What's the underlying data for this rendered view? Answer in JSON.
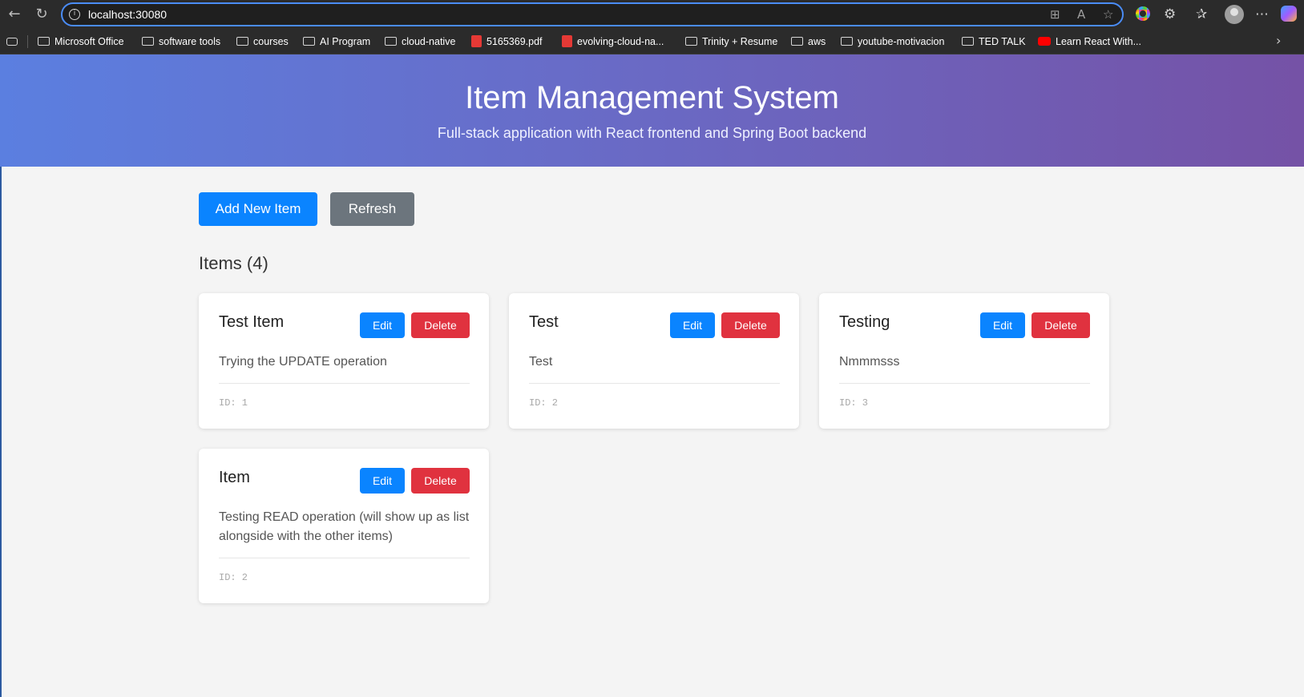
{
  "browser": {
    "url": "localhost:30080",
    "bookmarks": [
      {
        "label": "Microsoft Office",
        "type": "folder"
      },
      {
        "label": "software tools",
        "type": "folder"
      },
      {
        "label": "courses",
        "type": "folder"
      },
      {
        "label": "AI Program",
        "type": "folder"
      },
      {
        "label": "cloud-native",
        "type": "folder"
      },
      {
        "label": "5165369.pdf",
        "type": "pdf"
      },
      {
        "label": "evolving-cloud-na...",
        "type": "pdf"
      },
      {
        "label": "Trinity + Resume",
        "type": "folder"
      },
      {
        "label": "aws",
        "type": "folder"
      },
      {
        "label": "youtube-motivacion",
        "type": "folder"
      },
      {
        "label": "TED TALK",
        "type": "folder"
      },
      {
        "label": "Learn React With...",
        "type": "youtube"
      }
    ]
  },
  "header": {
    "title": "Item Management System",
    "subtitle": "Full-stack application with React frontend and Spring Boot backend"
  },
  "actions": {
    "add_label": "Add New Item",
    "refresh_label": "Refresh"
  },
  "items_heading": "Items (4)",
  "labels": {
    "edit": "Edit",
    "delete": "Delete"
  },
  "items": [
    {
      "name": "Test Item",
      "description": "Trying the UPDATE operation",
      "id_text": "ID: 1"
    },
    {
      "name": "Test",
      "description": "Test",
      "id_text": "ID: 2"
    },
    {
      "name": "Testing",
      "description": "Nmmmsss",
      "id_text": "ID: 3"
    },
    {
      "name": "Item",
      "description": "Testing READ operation (will show up as list alongside with the other items)",
      "id_text": "ID: 2"
    }
  ],
  "colors": {
    "primary": "#0a84ff",
    "secondary": "#6c757d",
    "danger": "#e0323f",
    "header_gradient_start": "#5b7fe0",
    "header_gradient_end": "#7552a6"
  }
}
